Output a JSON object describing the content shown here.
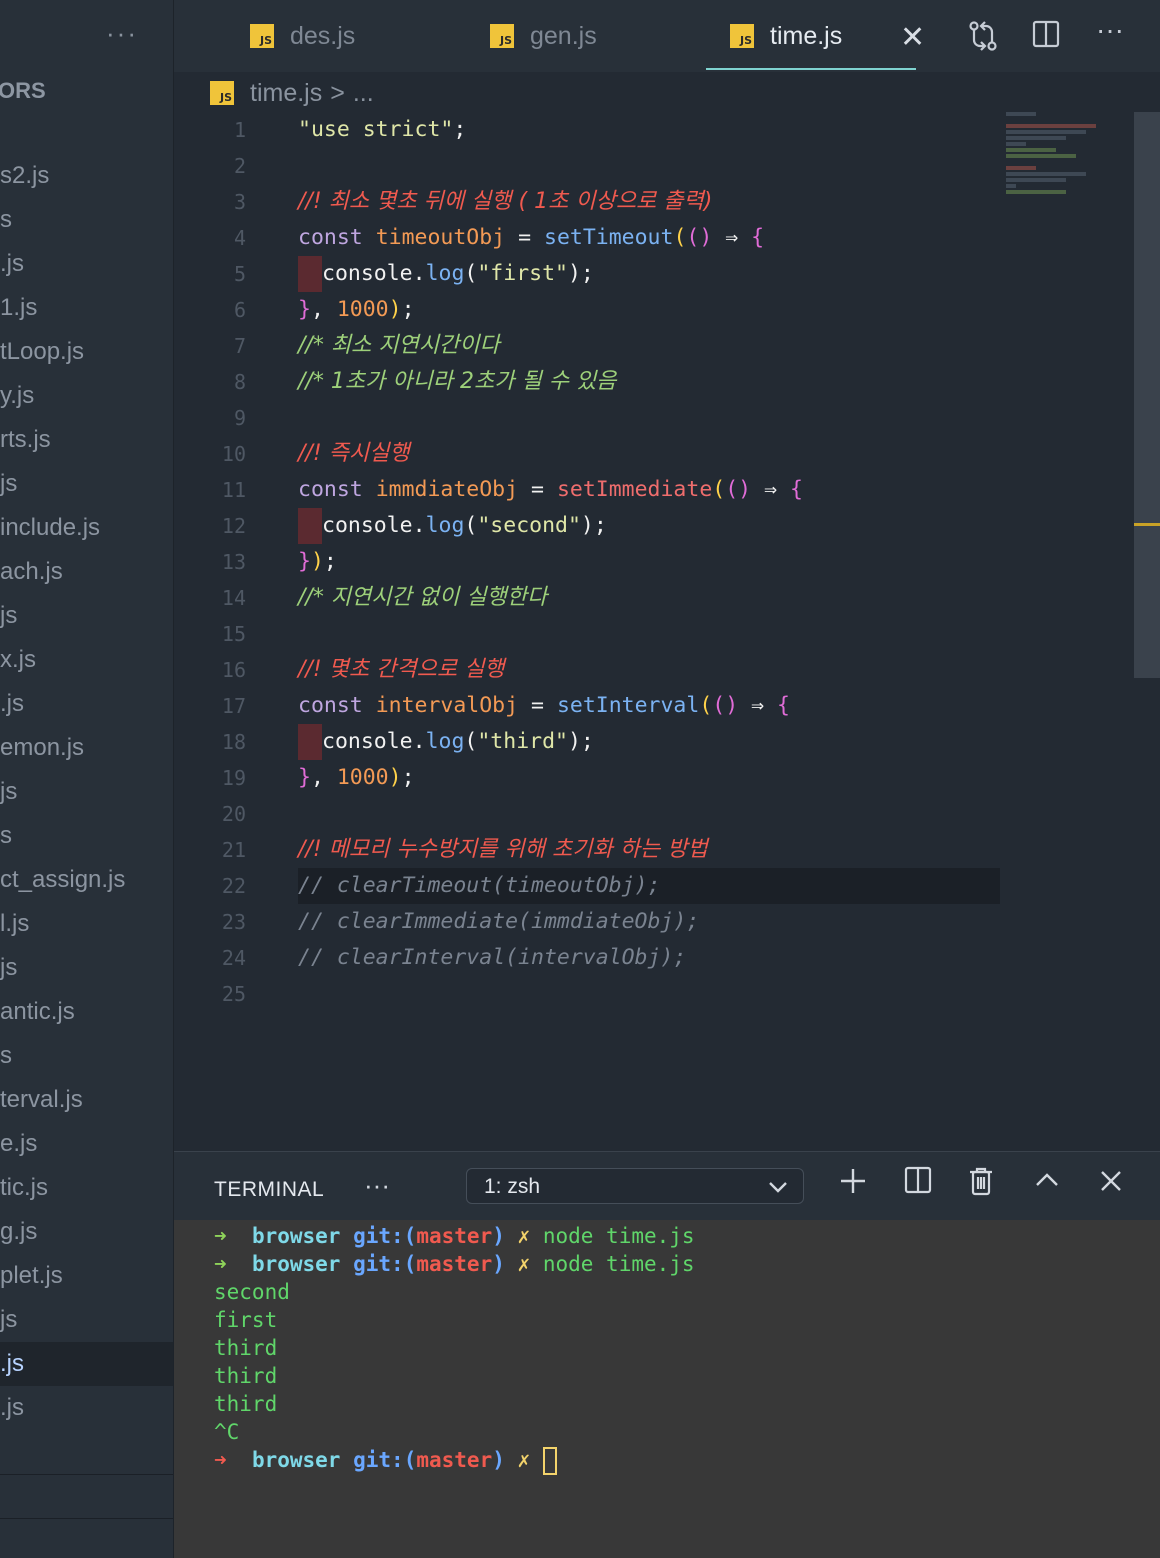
{
  "sidebar": {
    "section_title": "ORS",
    "files": [
      "s2.js",
      "s",
      ".js",
      "1.js",
      "tLoop.js",
      "y.js",
      "rts.js",
      "js",
      "include.js",
      "ach.js",
      "js",
      "x.js",
      ".js",
      "emon.js",
      "js",
      "s",
      "ct_assign.js",
      "l.js",
      "js",
      "antic.js",
      "s",
      "terval.js",
      "e.js",
      "tic.js",
      "g.js",
      "plet.js",
      "js",
      ".js",
      ".js"
    ]
  },
  "tabs": [
    {
      "label": "des.js"
    },
    {
      "label": "gen.js"
    },
    {
      "label": "time.js"
    }
  ],
  "js_badge": "JS",
  "breadcrumb": {
    "file": "time.js",
    "sep": ">",
    "rest": "..."
  },
  "editor": {
    "line_numbers": [
      "1",
      "2",
      "3",
      "4",
      "5",
      "6",
      "7",
      "8",
      "9",
      "10",
      "11",
      "12",
      "13",
      "14",
      "15",
      "16",
      "17",
      "18",
      "19",
      "20",
      "21",
      "22",
      "23",
      "24",
      "25"
    ],
    "l1_str": "\"use strict\"",
    "l1_semi": ";",
    "l3_comment": "//! 최소 몇초 뒤에 실행 ( 1초 이상으로 출력)",
    "l4_kw": "const",
    "l4_var": "timeoutObj",
    "l4_eq": "=",
    "l4_fn": "setTimeout",
    "l5_obj": "console",
    "l5_fn": "log",
    "l5_str": "\"first\"",
    "l6_num": "1000",
    "l7_comment": "//* 최소 지연시간이다",
    "l8_comment": "//* 1초가 아니라 2초가 될 수 있음",
    "l10_comment": "//! 즉시실행",
    "l11_var": "immdiateObj",
    "l11_fn": "setImmediate",
    "l12_str": "\"second\"",
    "l14_comment": "//* 지연시간 없이 실행한다",
    "l16_comment": "//! 몇초 간격으로 실행",
    "l17_var": "intervalObj",
    "l17_fn": "setInterval",
    "l18_str": "\"third\"",
    "l19_num": "1000",
    "l21_comment": "//! 메모리 누수방지를 위해 초기화 하는 방법",
    "l22_comment": "// clearTimeout(timeoutObj);",
    "l23_comment": "// clearImmediate(immdiateObj);",
    "l24_comment": "// clearInterval(intervalObj);"
  },
  "terminal": {
    "title": "TERMINAL",
    "shell_select": "1: zsh",
    "prompt_dir": "browser",
    "prompt_git": "git:",
    "prompt_branch_open": "(",
    "prompt_branch": "master",
    "prompt_branch_close": ")",
    "prompt_x": "✗",
    "command": "node time.js",
    "output": [
      "second",
      "first",
      "third",
      "third",
      "third",
      "^C"
    ]
  },
  "colors": {
    "accent_tab_underline": "#7fd3d0",
    "js_badge": "#f0c43a",
    "comment_red": "#f05a4f",
    "comment_green": "#9dd07a"
  }
}
